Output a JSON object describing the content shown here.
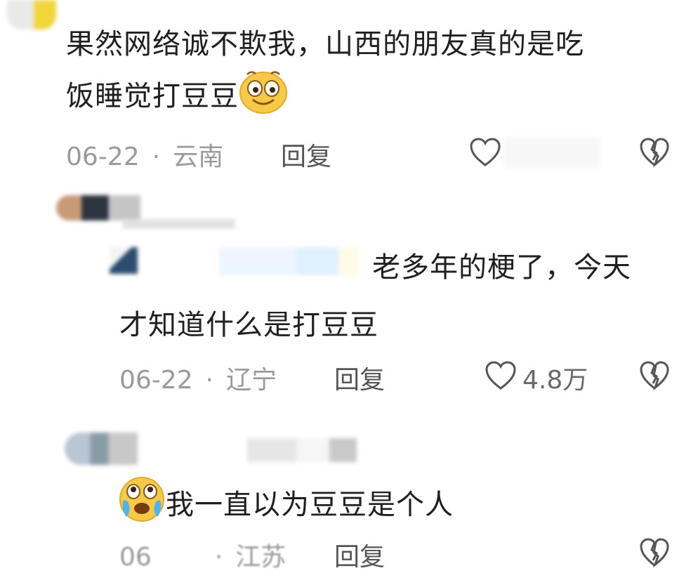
{
  "comments": [
    {
      "text_line1": "果然网络诚不欺我，山西的朋友真的是吃",
      "text_line2": "饭睡觉打豆豆",
      "date": "06-22",
      "location": "云南",
      "reply_label": "回复",
      "like_count": "",
      "emoji": "smiling-face-emoji"
    },
    {
      "text_line1": "老多年的梗了，今天",
      "text_line2": "才知道什么是打豆豆",
      "date": "06-22",
      "location": "辽宁",
      "reply_label": "回复",
      "like_count": "4.8万"
    },
    {
      "text_line1": "我一直以为豆豆是个人",
      "date": "06",
      "location": "江苏",
      "reply_label": "回复",
      "emoji": "crying-face-emoji"
    }
  ],
  "separator": "·",
  "colors": {
    "text": "#1f1f1f",
    "meta": "#9a9a9a",
    "icon": "#555555"
  }
}
